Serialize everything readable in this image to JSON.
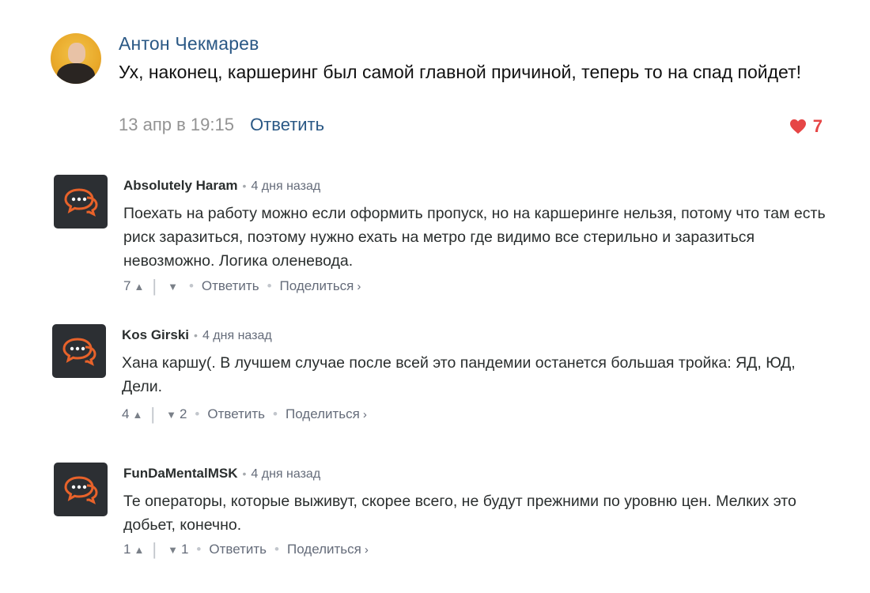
{
  "vk_post": {
    "author": "Антон Чекмарев",
    "text": "Ух, наконец, каршеринг был самой главной причиной, теперь то на спад пойдет!",
    "date": "13 апр в 19:15",
    "reply_label": "Ответить",
    "likes": "7",
    "colors": {
      "link": "#2a5885",
      "like": "#e64646"
    }
  },
  "comments": [
    {
      "author": "Absolutely Haram",
      "time": "4 дня назад",
      "text": "Поехать на работу можно если оформить пропуск, но на каршеринге нельзя, потому что там есть риск заразиться, поэтому нужно ехать на метро где видимо все стерильно и заразиться невозможно. Логика оленевода.",
      "upvotes": "7",
      "downvotes": "",
      "reply_label": "Ответить",
      "share_label": "Поделиться"
    },
    {
      "author": "Kos Girski",
      "time": "4 дня назад",
      "text": "Хана каршу(. В лучшем случае после всей это пандемии останется большая тройка: ЯД, ЮД, Дели.",
      "upvotes": "4",
      "downvotes": "2",
      "reply_label": "Ответить",
      "share_label": "Поделиться"
    },
    {
      "author": "FunDaMentalMSK",
      "time": "4 дня назад",
      "text": "Те операторы, которые выживут, скорее всего, не будут прежними по уровню цен. Мелких это добьет, конечно.",
      "upvotes": "1",
      "downvotes": "1",
      "reply_label": "Ответить",
      "share_label": "Поделиться"
    }
  ],
  "icons": {
    "avatar_comment": "speech-bubbles-icon",
    "upvote": "chevron-up-icon",
    "downvote": "chevron-down-icon",
    "like": "heart-icon"
  }
}
